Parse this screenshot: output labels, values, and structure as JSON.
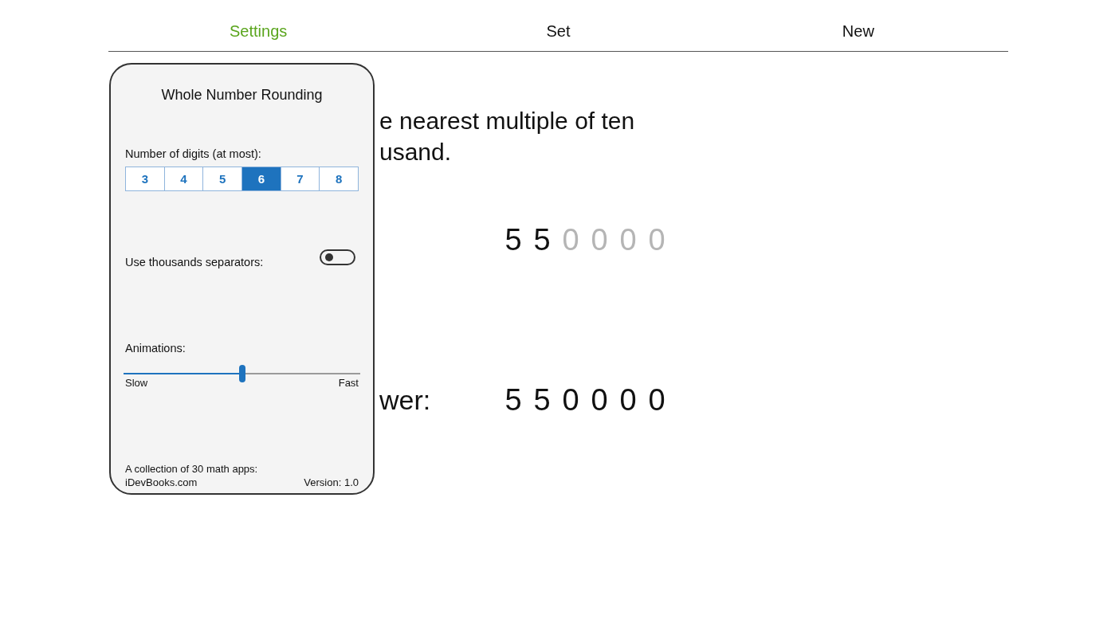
{
  "tabs": [
    {
      "label": "Settings",
      "selected": true
    },
    {
      "label": "Set",
      "selected": false
    },
    {
      "label": "New",
      "selected": false
    }
  ],
  "question": {
    "lines": [
      "e nearest multiple of ten",
      "usand."
    ]
  },
  "problem": {
    "digits": [
      {
        "text": "5",
        "dimmed": false
      },
      {
        "text": "5",
        "dimmed": false
      },
      {
        "text": "0",
        "dimmed": true
      },
      {
        "text": "0",
        "dimmed": true
      },
      {
        "text": "0",
        "dimmed": true
      },
      {
        "text": "0",
        "dimmed": true
      }
    ]
  },
  "answer": {
    "label": "wer:",
    "digits": [
      {
        "text": "5",
        "dimmed": false
      },
      {
        "text": "5",
        "dimmed": false
      },
      {
        "text": "0",
        "dimmed": false
      },
      {
        "text": "0",
        "dimmed": false
      },
      {
        "text": "0",
        "dimmed": false
      },
      {
        "text": "0",
        "dimmed": false
      }
    ]
  },
  "settings": {
    "title": "Whole Number Rounding",
    "digits_label": "Number of digits (at most):",
    "digit_options": [
      {
        "label": "3",
        "selected": false
      },
      {
        "label": "4",
        "selected": false
      },
      {
        "label": "5",
        "selected": false
      },
      {
        "label": "6",
        "selected": true
      },
      {
        "label": "7",
        "selected": false
      },
      {
        "label": "8",
        "selected": false
      }
    ],
    "separators": {
      "label": "Use thousands separators:",
      "on": false
    },
    "animations": {
      "label": "Animations:",
      "level": 0.5,
      "min_label": "Slow",
      "max_label": "Fast"
    },
    "footer": {
      "collection": "A collection of 30 math apps:",
      "site": "iDevBooks.com",
      "version": "Version: 1.0"
    }
  }
}
